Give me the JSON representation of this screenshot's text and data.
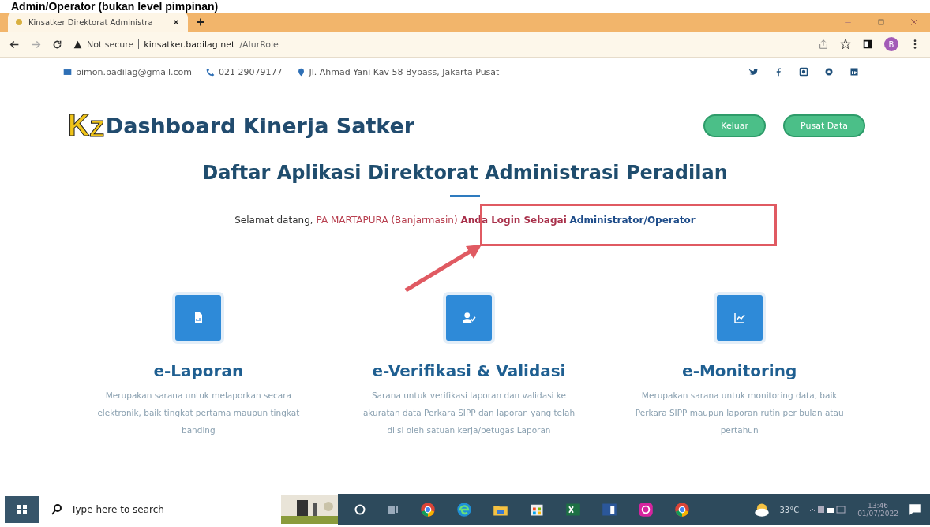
{
  "caption": "Admin/Operator (bukan level pimpinan)",
  "browser": {
    "tab_title": "Kinsatker Direktorat Administra",
    "security": "Not secure",
    "url_host": "kinsatker.badilag.net",
    "url_path": "/AlurRole",
    "profile": "B"
  },
  "contact": {
    "email": "bimon.badilag@gmail.com",
    "phone": "021 29079177",
    "address": "Jl. Ahmad Yani Kav 58 Bypass, Jakarta Pusat"
  },
  "social": [
    {
      "kind": "twitter"
    },
    {
      "kind": "facebook"
    },
    {
      "kind": "instagram"
    },
    {
      "kind": "skype"
    },
    {
      "kind": "linkedin"
    }
  ],
  "header": {
    "logo_letters": "K",
    "logo_letters2": "Z",
    "title": "Dashboard Kinerja Satker",
    "buttons": [
      "Keluar",
      "Pusat Data"
    ]
  },
  "page_title": "Daftar Aplikasi Direktorat Administrasi Peradilan",
  "welcome": {
    "greeting": "Selamat datang,",
    "place": "PA MARTAPURA (Banjarmasin)",
    "label": "Anda Login Sebagai",
    "role": "Administrator/Operator"
  },
  "apps": [
    {
      "kind": "report",
      "title": "e-Laporan",
      "description": "Merupakan sarana untuk melaporkan secara elektronik, baik tingkat pertama maupun tingkat banding"
    },
    {
      "kind": "verify",
      "title": "e-Verifikasi & Validasi",
      "description": "Sarana untuk verifikasi laporan dan validasi ke akuratan data Perkara SIPP dan laporan yang telah diisi oleh satuan kerja/petugas Laporan"
    },
    {
      "kind": "chart",
      "title": "e-Monitoring",
      "description": "Merupakan sarana untuk monitoring data, baik Perkara SIPP maupun laporan rutin per bulan atau pertahun"
    }
  ],
  "taskbar": {
    "search_placeholder": "Type here to search",
    "apps": [
      {
        "kind": "cortana"
      },
      {
        "kind": "taskview"
      },
      {
        "kind": "chrome"
      },
      {
        "kind": "edge"
      },
      {
        "kind": "files"
      },
      {
        "kind": "store"
      },
      {
        "kind": "excel"
      },
      {
        "kind": "word"
      },
      {
        "kind": "instagram"
      },
      {
        "kind": "chrome2"
      }
    ],
    "temperature": "33°C",
    "time": "13:46",
    "date": "01/07/2022"
  }
}
